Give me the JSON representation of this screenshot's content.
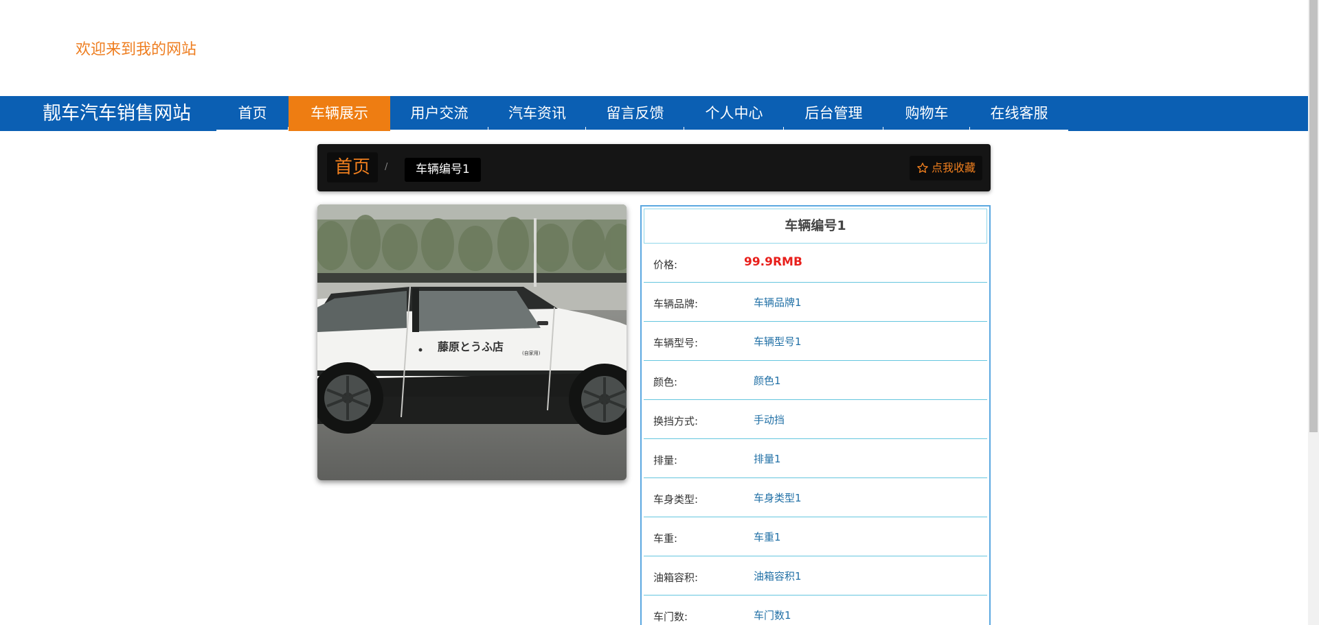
{
  "header": {
    "welcome_text": "欢迎来到我的网站"
  },
  "nav": {
    "brand": "靓车汽车销售网站",
    "items": [
      {
        "label": "首页",
        "active": false
      },
      {
        "label": "车辆展示",
        "active": true
      },
      {
        "label": "用户交流",
        "active": false
      },
      {
        "label": "汽车资讯",
        "active": false
      },
      {
        "label": "留言反馈",
        "active": false
      },
      {
        "label": "个人中心",
        "active": false
      },
      {
        "label": "后台管理",
        "active": false
      },
      {
        "label": "购物车",
        "active": false
      },
      {
        "label": "在线客服",
        "active": false
      }
    ]
  },
  "breadcrumb": {
    "home": "首页",
    "separator": "/",
    "current": "车辆编号1",
    "favorite_label": "点我收藏",
    "favorite_icon": "star-outline-icon"
  },
  "car": {
    "image_door_text": "藤原とうふ店",
    "image_door_subtext": "(自家用)",
    "title": "车辆编号1",
    "fields": [
      {
        "key": "price",
        "label": "价格:",
        "value": "99.9RMB"
      },
      {
        "key": "brand",
        "label": "车辆品牌:",
        "value": "车辆品牌1"
      },
      {
        "key": "model",
        "label": "车辆型号:",
        "value": "车辆型号1"
      },
      {
        "key": "color",
        "label": "颜色:",
        "value": "颜色1"
      },
      {
        "key": "transmission",
        "label": "换挡方式:",
        "value": "手动挡"
      },
      {
        "key": "displacement",
        "label": "排量:",
        "value": "排量1"
      },
      {
        "key": "body_type",
        "label": "车身类型:",
        "value": "车身类型1"
      },
      {
        "key": "weight",
        "label": "车重:",
        "value": "车重1"
      },
      {
        "key": "tank",
        "label": "油箱容积:",
        "value": "油箱容积1"
      },
      {
        "key": "doors",
        "label": "车门数:",
        "value": "车门数1"
      }
    ]
  },
  "colors": {
    "nav_blue": "#0b5fb3",
    "accent_orange": "#ee7d12",
    "price_red": "#e8201c",
    "value_blue": "#2170a6"
  }
}
